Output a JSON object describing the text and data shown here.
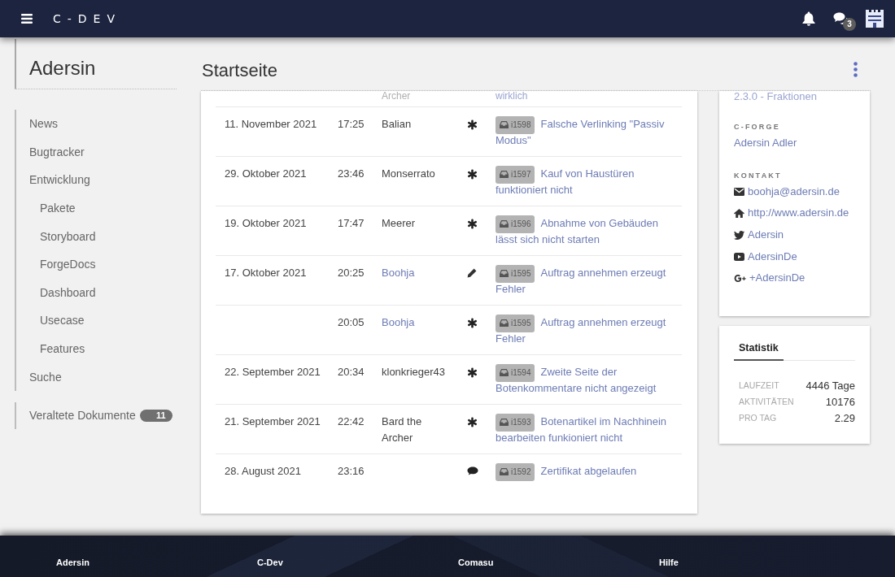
{
  "topbar": {
    "logo": "C-DEV",
    "messages_badge": "3"
  },
  "sidebar": {
    "title": "Adersin",
    "nav": [
      {
        "label": "News"
      },
      {
        "label": "Bugtracker"
      },
      {
        "label": "Entwicklung",
        "children": [
          {
            "label": "Pakete"
          },
          {
            "label": "Storyboard"
          },
          {
            "label": "ForgeDocs"
          },
          {
            "label": "Dashboard"
          },
          {
            "label": "Usecase"
          },
          {
            "label": "Features"
          }
        ]
      },
      {
        "label": "Suche"
      }
    ],
    "extra_nav": [
      {
        "label": "Veraltete Dokumente",
        "badge": "11"
      }
    ]
  },
  "page": {
    "title": "Startseite"
  },
  "activity": {
    "partial_row": {
      "author": "Archer",
      "title": "wirklich"
    },
    "rows": [
      {
        "date": "11. November 2021",
        "time": "17:25",
        "author": "Balian",
        "author_link": false,
        "kind": "new",
        "ticket": "i1598",
        "title": "Falsche Verlinking \"Passiv Modus\""
      },
      {
        "date": "29. Oktober 2021",
        "time": "23:46",
        "author": "Monserrato",
        "author_link": false,
        "kind": "new",
        "ticket": "i1597",
        "title": "Kauf von Haustüren funktioniert nicht"
      },
      {
        "date": "19. Oktober 2021",
        "time": "17:47",
        "author": "Meerer",
        "author_link": false,
        "kind": "new",
        "ticket": "i1596",
        "title": "Abnahme von Gebäuden lässt sich nicht starten"
      },
      {
        "date": "17. Oktober 2021",
        "time": "20:25",
        "author": "Boohja",
        "author_link": true,
        "kind": "edit",
        "ticket": "i1595",
        "title": "Auftrag annehmen erzeugt Fehler"
      },
      {
        "time": "20:05",
        "author": "Boohja",
        "author_link": true,
        "kind": "new",
        "ticket": "i1595",
        "title": "Auftrag annehmen erzeugt Fehler"
      },
      {
        "date": "22. September 2021",
        "time": "20:34",
        "author": "klonkrieger43",
        "author_link": false,
        "kind": "new",
        "ticket": "i1594",
        "title": "Zweite Seite der Botenkommentare nicht angezeigt"
      },
      {
        "date": "21. September 2021",
        "time": "22:42",
        "author": "Bard the Archer",
        "author_link": false,
        "kind": "new",
        "ticket": "i1593",
        "title": "Botenartikel im Nachhinein bearbeiten funkioniert nicht"
      },
      {
        "date": "28. August 2021",
        "time": "23:16",
        "kind": "comment",
        "ticket": "i1592",
        "title": "Zertifikat abgelaufen"
      }
    ]
  },
  "project_card": {
    "version": "2.3.0 - Fraktionen",
    "sections": [
      {
        "heading": "C-FORGE",
        "links": [
          {
            "kind": "plain",
            "label": "Adersin Adler"
          }
        ]
      },
      {
        "heading": "KONTAKT",
        "links": [
          {
            "kind": "email",
            "label": "boohja@adersin.de"
          },
          {
            "kind": "website",
            "label": "http://www.adersin.de"
          },
          {
            "kind": "twitter",
            "label": "Adersin"
          },
          {
            "kind": "youtube",
            "label": "AdersinDe"
          },
          {
            "kind": "googleplus",
            "label": "+AdersinDe"
          }
        ]
      }
    ]
  },
  "stats_card": {
    "tabs": [
      {
        "label": "Statistik",
        "selected": true
      }
    ],
    "rows": [
      {
        "label": "LAUFZEIT",
        "value": "4446 Tage"
      },
      {
        "label": "AKTIVITÄTEN",
        "value": "10176"
      },
      {
        "label": "PRO TAG",
        "value": "2.29"
      }
    ]
  },
  "footer": {
    "links": [
      "Adersin",
      "C-Dev",
      "Comasu",
      "Hilfe"
    ]
  }
}
